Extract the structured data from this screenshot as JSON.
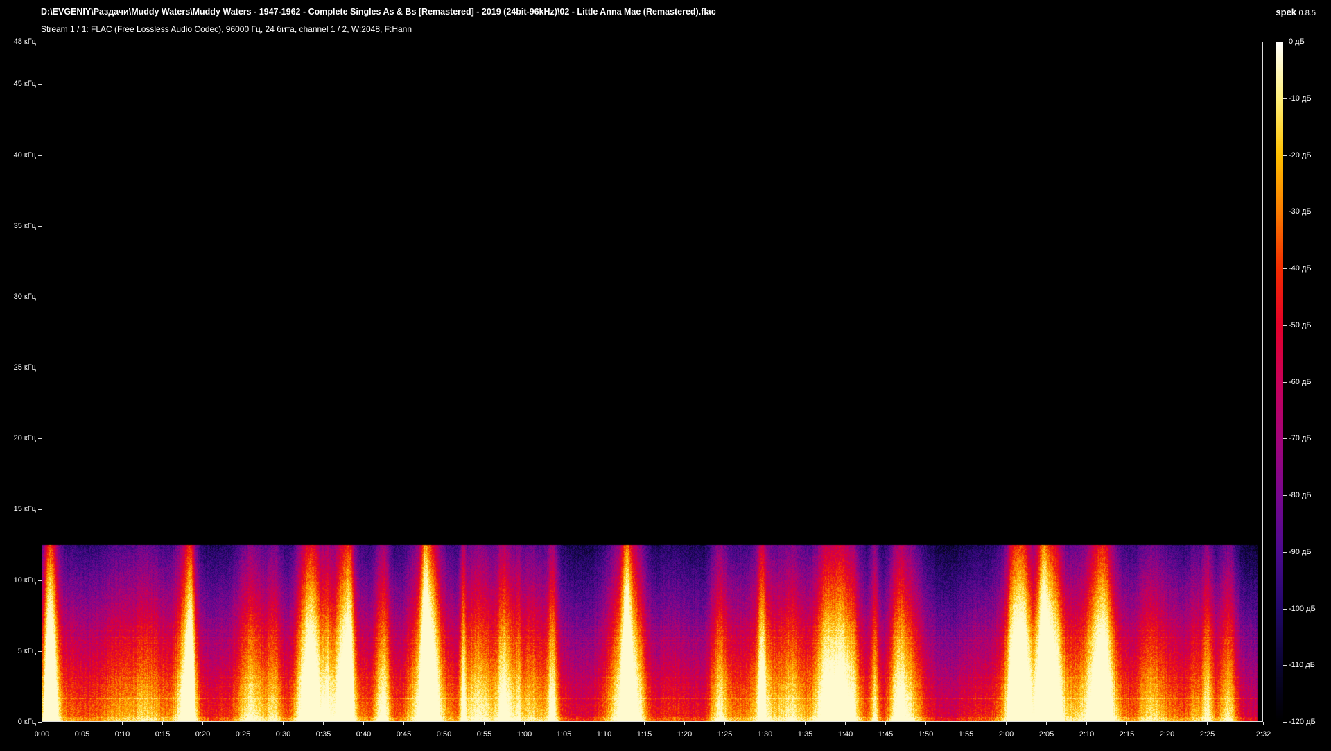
{
  "window": {
    "title": "D:\\EVGENIY\\Раздачи\\Muddy Waters\\Muddy Waters - 1947-1962 - Complete Singles As & Bs [Remastered] - 2019 (24bit-96kHz)\\02 - Little Anna Mae (Remastered).flac",
    "stream_info": "Stream 1 / 1: FLAC (Free Lossless Audio Codec), 96000 Гц, 24 бита, channel 1 / 2, W:2048, F:Hann",
    "app_name": "spek",
    "app_version": "0.8.5"
  },
  "chart_data": {
    "type": "heatmap",
    "kind": "spectrogram",
    "title": "",
    "xlabel": "",
    "ylabel": "",
    "x_unit": "time",
    "y_unit": "кГц",
    "xlim": [
      "0:00",
      "2:32"
    ],
    "ylim": [
      0,
      48
    ],
    "x_ticks": [
      "0:00",
      "0:05",
      "0:10",
      "0:15",
      "0:20",
      "0:25",
      "0:30",
      "0:35",
      "0:40",
      "0:45",
      "0:50",
      "0:55",
      "1:00",
      "1:05",
      "1:10",
      "1:15",
      "1:20",
      "1:25",
      "1:30",
      "1:35",
      "1:40",
      "1:45",
      "1:50",
      "1:55",
      "2:00",
      "2:05",
      "2:10",
      "2:15",
      "2:20",
      "2:25",
      "2:32"
    ],
    "y_ticks": [
      "0 кГц",
      "5 кГц",
      "10 кГц",
      "15 кГц",
      "20 кГц",
      "25 кГц",
      "30 кГц",
      "35 кГц",
      "40 кГц",
      "45 кГц",
      "48 кГц"
    ],
    "y_tick_values": [
      0,
      5,
      10,
      15,
      20,
      25,
      30,
      35,
      40,
      45,
      48
    ],
    "colorbar_ticks": [
      "0 дБ",
      "-10 дБ",
      "-20 дБ",
      "-30 дБ",
      "-40 дБ",
      "-50 дБ",
      "-60 дБ",
      "-70 дБ",
      "-80 дБ",
      "-90 дБ",
      "-100 дБ",
      "-110 дБ",
      "-120 дБ"
    ],
    "colorbar_values": [
      0,
      -10,
      -20,
      -30,
      -40,
      -50,
      -60,
      -70,
      -80,
      -90,
      -100,
      -110,
      -120
    ],
    "colorbar_range_db": [
      -120,
      0
    ],
    "content_cutoff_khz": 12.5,
    "duration_s": 152,
    "colormap": [
      "#000000",
      "#0a0530",
      "#22086a",
      "#4b0a8e",
      "#78078f",
      "#a3047a",
      "#c8005a",
      "#e4002a",
      "#f42c00",
      "#fb7c00",
      "#ffc000",
      "#fff07a",
      "#ffffff"
    ]
  }
}
